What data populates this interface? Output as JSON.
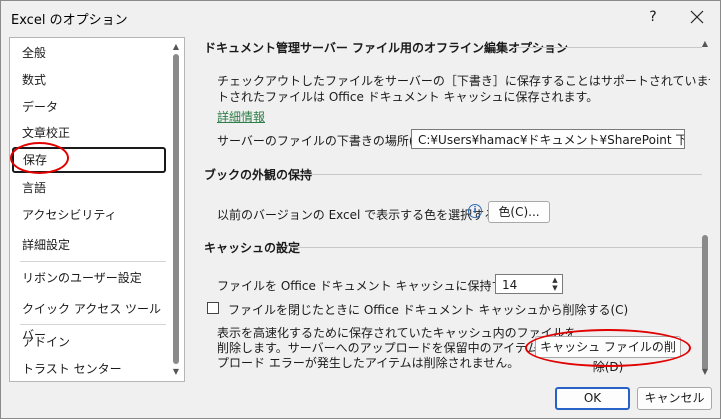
{
  "window": {
    "title": "Excel のオプション",
    "help_label": "?"
  },
  "sidebar": {
    "items": [
      {
        "label": "全般"
      },
      {
        "label": "数式"
      },
      {
        "label": "データ"
      },
      {
        "label": "文章校正"
      },
      {
        "label": "保存",
        "selected": true
      },
      {
        "label": "言語"
      },
      {
        "label": "アクセシビリティ"
      },
      {
        "label": "詳細設定"
      },
      {
        "label": "リボンのユーザー設定"
      },
      {
        "label": "クイック アクセス ツール バー"
      },
      {
        "label": "アドイン"
      },
      {
        "label": "トラスト センター"
      }
    ]
  },
  "offline": {
    "heading": "ドキュメント管理サーバー ファイル用のオフライン編集オプション",
    "desc_line1": "チェックアウトしたファイルをサーバーの［下書き］に保存することはサポートされていません。チェックアウ",
    "desc_line2": "トされたファイルは Office ドキュメント キャッシュに保存されます。",
    "link": "詳細情報",
    "location_label": "サーバーのファイルの下書きの場所(V):",
    "location_value": "C:¥Users¥hamac¥ドキュメント¥SharePoint 下書き"
  },
  "appearance": {
    "heading": "ブックの外観の保持",
    "color_label": "以前のバージョンの Excel で表示する色を選択する:",
    "color_button": "色(C)..."
  },
  "cache": {
    "heading": "キャッシュの設定",
    "days_label": "ファイルを Office ドキュメント キャッシュに保持する日数:",
    "days_value": "14",
    "delete_on_close_label": "ファイルを閉じたときに Office ドキュメント キャッシュから削除する(C)",
    "delete_on_close_checked": false,
    "desc_line1": "表示を高速化するために保存されていたキャッシュ内のファイルを",
    "desc_line2": "削除します。サーバーへのアップロードを保留中のアイテムや、アッ",
    "desc_line3": "プロード エラーが発生したアイテムは削除されません。",
    "delete_button": "キャッシュ ファイルの削除(D)"
  },
  "footer": {
    "ok": "OK",
    "cancel": "キャンセル"
  },
  "colors": {
    "highlight_oval": "#e00000",
    "link": "#2d7d46",
    "ok_border": "#2862c9"
  }
}
